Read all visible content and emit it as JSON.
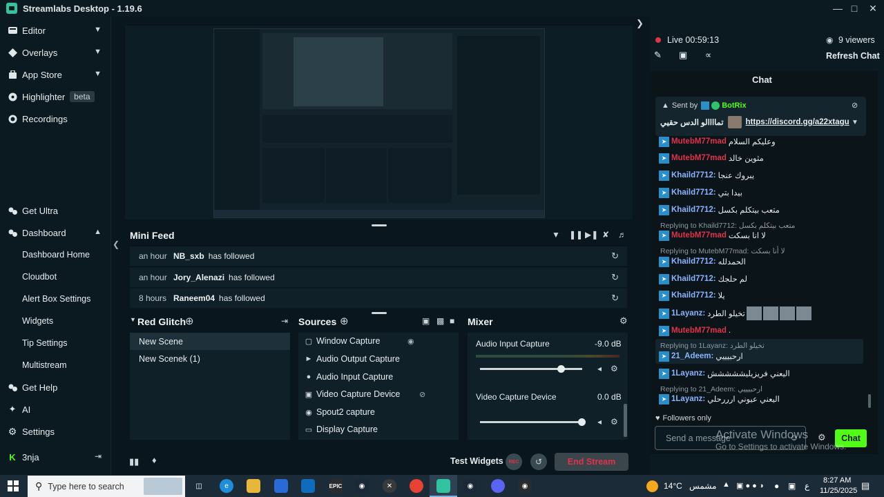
{
  "app": {
    "title": "Streamlabs Desktop - 1.19.6"
  },
  "sidebar": {
    "items": [
      {
        "label": "Editor"
      },
      {
        "label": "Overlays"
      },
      {
        "label": "App Store"
      },
      {
        "label": "Highlighter",
        "badge": "beta"
      },
      {
        "label": "Recordings"
      },
      {
        "label": "Get Ultra"
      },
      {
        "label": "Dashboard"
      }
    ],
    "dashboard_sub": [
      "Dashboard Home",
      "Cloudbot",
      "Alert Box Settings",
      "Widgets",
      "Tip Settings",
      "Multistream"
    ],
    "bottom": [
      {
        "label": "Get Help"
      },
      {
        "label": "AI"
      },
      {
        "label": "Settings"
      }
    ],
    "user": "3nja"
  },
  "minifeed": {
    "title": "Mini Feed",
    "rows": [
      {
        "time": "an hour",
        "name": "NB_sxb",
        "action": "has followed"
      },
      {
        "time": "an hour",
        "name": "Jory_Alenazi",
        "action": "has followed"
      },
      {
        "time": "8 hours",
        "name": "Raneem04",
        "action": "has followed"
      }
    ]
  },
  "scenes": {
    "title": "Red Glitch",
    "items": [
      "New Scene",
      "New Scenek (1)"
    ]
  },
  "sources": {
    "title": "Sources",
    "items": [
      "Window Capture",
      "Audio Output Capture",
      "Audio Input Capture",
      "Video Capture Device",
      "Spout2 capture",
      "Display Capture"
    ]
  },
  "mixer": {
    "title": "Mixer",
    "channels": [
      {
        "name": "Audio Input Capture",
        "db": "-9.0 dB",
        "level": 0.8
      },
      {
        "name": "Video Capture Device",
        "db": "0.0 dB",
        "level": 1.0
      }
    ]
  },
  "bottombar": {
    "test_widgets": "Test Widgets",
    "rec": "REC",
    "end_stream": "End Stream"
  },
  "stream": {
    "live_time": "Live 00:59:13",
    "viewers": "9 viewers",
    "refresh": "Refresh Chat"
  },
  "chat": {
    "title": "Chat",
    "pinned": {
      "sent_by": "Sent by",
      "bot": "BotRix",
      "text": "تماااالو الدس حقيي",
      "link": "https://discord.gg/a22xtagu"
    },
    "messages": [
      {
        "user": "MutebM77mad",
        "color": "#e0334a",
        "text": "وعليكم السلام"
      },
      {
        "user": "MutebM77mad",
        "color": "#e0334a",
        "text": "مثوين خالد"
      },
      {
        "user": "Khaild7712:",
        "color": "#8ab4ff",
        "text": "يبروك عنجا"
      },
      {
        "user": "Khaild7712:",
        "color": "#8ab4ff",
        "text": "بيدا بتي"
      },
      {
        "user": "Khaild7712:",
        "color": "#8ab4ff",
        "text": "متعب بيتكلم بكسل"
      },
      {
        "reply": "Replying to Khaild7712: متعب بيتكلم بكسل"
      },
      {
        "user": "MutebM77mad",
        "color": "#e0334a",
        "text": "لا انا بسكت"
      },
      {
        "reply": "Replying to MutebM77mad: لا أنا بسكت"
      },
      {
        "user": "Khaild7712:",
        "color": "#8ab4ff",
        "text": "الحمدلله"
      },
      {
        "user": "Khaild7712:",
        "color": "#8ab4ff",
        "text": "لم حلجك"
      },
      {
        "user": "Khaild7712:",
        "color": "#8ab4ff",
        "text": "يلا"
      },
      {
        "user": "1Layanz:",
        "color": "#8ab4ff",
        "text": "تخيلو الطرد"
      },
      {
        "user": "MutebM77mad",
        "color": "#e0334a",
        "text": "."
      },
      {
        "reply": "Replying to 1Layanz: تخيلو الطرد"
      },
      {
        "user": "21_Adeem:",
        "color": "#8ab4ff",
        "text": "ارحبيييي"
      },
      {
        "user": "1Layanz:",
        "color": "#8ab4ff",
        "text": "اليعني فريزيليششششش"
      },
      {
        "reply": "Replying to 21_Adeem: ارحبيييي"
      },
      {
        "user": "1Layanz:",
        "color": "#8ab4ff",
        "text": "اليعني عيوني ارررحلي"
      }
    ],
    "followers_only": "Followers only",
    "input_placeholder": "Send a message",
    "send": "Chat"
  },
  "watermark": {
    "line1": "Activate Windows",
    "line2": "Go to Settings to activate Windows."
  },
  "taskbar": {
    "search_placeholder": "Type here to search",
    "weather": "14°C",
    "weather_label": "مشمس",
    "time": "8:27 AM",
    "date": "11/25/2025",
    "lang": "ع"
  },
  "colors": {
    "accent": "#31c3a2",
    "end_stream": "#e0334a"
  }
}
